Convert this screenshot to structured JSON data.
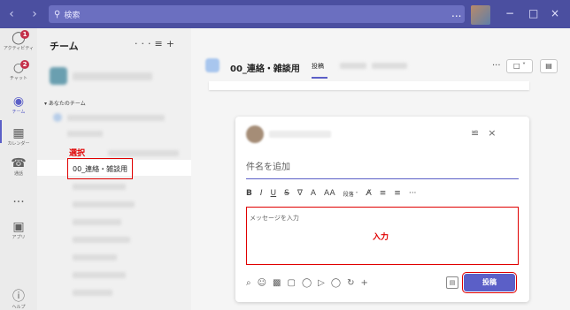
{
  "titlebar": {
    "back_icon": "chevron-left-icon",
    "forward_icon": "chevron-right-icon",
    "search_placeholder": "検索",
    "more_label": "...",
    "minimize_label": "−",
    "maximize_label": "□",
    "close_label": "×"
  },
  "rail": {
    "items": [
      {
        "label": "アクティビティ",
        "icon": "bell-icon",
        "badge": "1"
      },
      {
        "label": "チャット",
        "icon": "chat-icon",
        "badge": "2"
      },
      {
        "label": "チーム",
        "icon": "teams-icon",
        "active": true
      },
      {
        "label": "カレンダー",
        "icon": "calendar-icon"
      },
      {
        "label": "通話",
        "icon": "phone-icon"
      },
      {
        "label": "...",
        "icon": "more-icon"
      },
      {
        "label": "アプリ",
        "icon": "apps-icon"
      },
      {
        "label": "ヘルプ",
        "icon": "help-icon"
      }
    ]
  },
  "teams_panel": {
    "title": "チーム",
    "section_label": "あなたのチーム",
    "selected_channel": "00_連絡・雑談用",
    "annotation_select": "選択"
  },
  "channel": {
    "title": "00_連絡・雑談用",
    "active_tab": "投稿"
  },
  "compose": {
    "subject_placeholder": "件名を追加",
    "message_placeholder": "メッセージを入力",
    "annotation_input": "入力",
    "post_button": "投稿",
    "format_paragraph": "段落"
  },
  "colors": {
    "brand": "#5b5fc7",
    "titlebar": "#4b4fa0",
    "annotation": "#e00000",
    "badge": "#c4314b"
  }
}
